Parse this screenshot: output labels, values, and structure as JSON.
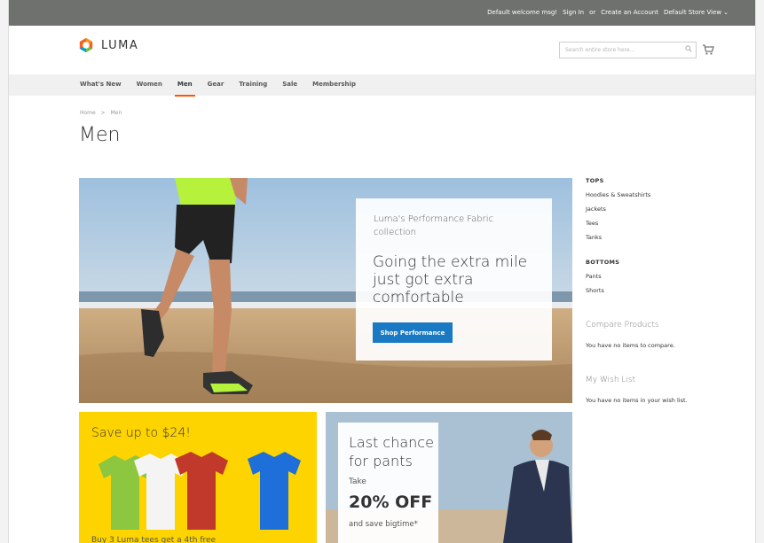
{
  "topbar": {
    "welcome": "Default welcome msg!",
    "sign_in": "Sign In",
    "or": "or",
    "create_account": "Create an Account",
    "store_view": "Default Store View"
  },
  "header": {
    "logo_text": "LUMA",
    "search_placeholder": "Search entire store here...",
    "brand_color": "#ff5501"
  },
  "nav": {
    "items": [
      "What's New",
      "Women",
      "Men",
      "Gear",
      "Training",
      "Sale",
      "Membership"
    ],
    "active": "Men"
  },
  "breadcrumb": {
    "home": "Home",
    "sep": ">",
    "current": "Men"
  },
  "page": {
    "title": "Men"
  },
  "hero": {
    "subtitle": "Luma's Performance Fabric collection",
    "headline": "Going the extra mile just got extra comfortable",
    "button_label": "Shop Performance",
    "button_color": "#1979c3"
  },
  "tiles": {
    "yellow": {
      "title": "Save up to $24!",
      "subtitle": "Buy 3 Luma tees get a 4th free"
    },
    "pants": {
      "title": "Last chance for pants",
      "take": "Take",
      "discount": "20% OFF",
      "save": "and save bigtime*"
    }
  },
  "sidebar": {
    "tops_heading": "TOPS",
    "tops": [
      "Hoodies & Sweatshirts",
      "Jackets",
      "Tees",
      "Tanks"
    ],
    "bottoms_heading": "BOTTOMS",
    "bottoms": [
      "Pants",
      "Shorts"
    ],
    "compare_title": "Compare Products",
    "compare_note": "You have no items to compare.",
    "wishlist_title": "My Wish List",
    "wishlist_note": "You have no items in your wish list."
  }
}
